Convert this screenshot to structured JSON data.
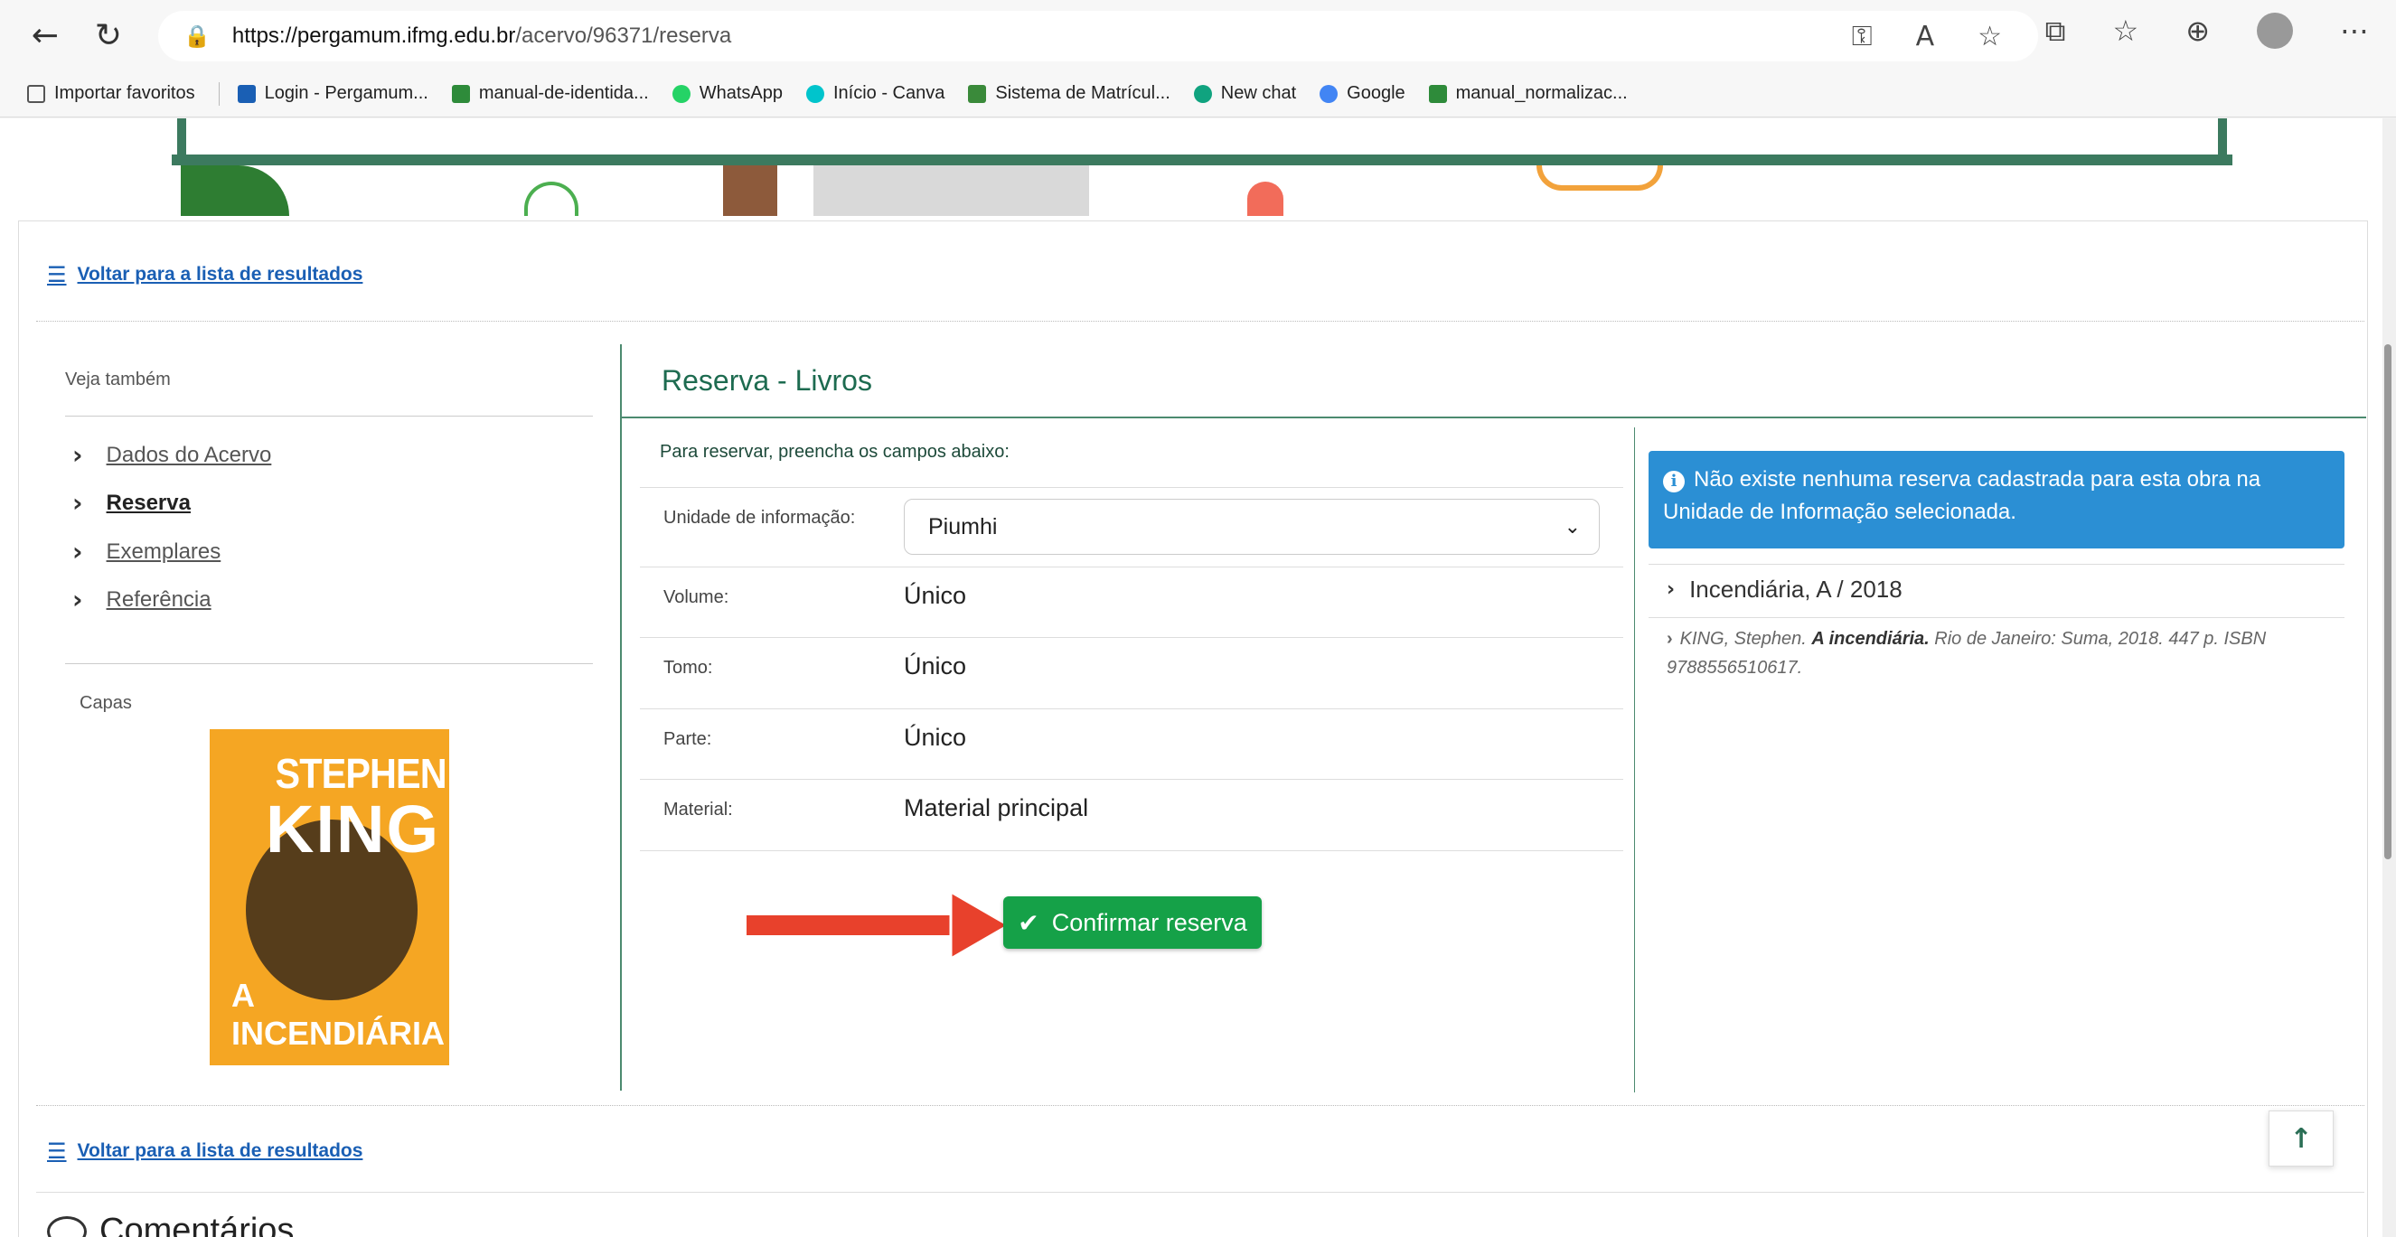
{
  "browser": {
    "url_host": "https://pergamum.ifmg.edu.br",
    "url_path": "/acervo/96371/reserva",
    "back_icon": "arrow-left-icon",
    "reload_icon": "reload-icon"
  },
  "bookmarks": [
    {
      "label": "Importar favoritos",
      "color": "#555555"
    },
    {
      "label": "Login - Pergamum...",
      "color": "#1a5fb4"
    },
    {
      "label": "manual-de-identida...",
      "color": "#2e8b3a"
    },
    {
      "label": "WhatsApp",
      "color": "#25d366"
    },
    {
      "label": "Início - Canva",
      "color": "#00c4cc"
    },
    {
      "label": "Sistema de Matrícul...",
      "color": "#3a8a3a"
    },
    {
      "label": "New chat",
      "color": "#10a37f"
    },
    {
      "label": "Google",
      "color": "#4285f4"
    },
    {
      "label": "manual_normalizac...",
      "color": "#2e8b3a"
    }
  ],
  "nav": {
    "back_to_results": "Voltar para a lista de resultados"
  },
  "sidebar": {
    "heading": "Veja também",
    "items": [
      {
        "label": "Dados do Acervo"
      },
      {
        "label": "Reserva"
      },
      {
        "label": "Exemplares"
      },
      {
        "label": "Referência"
      }
    ],
    "covers_label": "Capas",
    "cover_author_1": "STEPHEN",
    "cover_author_2": "KING",
    "cover_title": "A INCENDIÁRIA"
  },
  "main": {
    "title": "Reserva - Livros",
    "instructions": "Para reservar, preencha os campos abaixo:",
    "fields": [
      {
        "label": "Unidade de informação:",
        "value": "Piumhi"
      },
      {
        "label": "Volume:",
        "value": "Único"
      },
      {
        "label": "Tomo:",
        "value": "Único"
      },
      {
        "label": "Parte:",
        "value": "Único"
      },
      {
        "label": "Material:",
        "value": "Material principal"
      }
    ],
    "confirm_label": "Confirmar reserva"
  },
  "right_panel": {
    "info": "Não existe nenhuma reserva cadastrada para esta obra na Unidade de Informação selecionada.",
    "ref_title": "Incendiária, A / 2018",
    "ref_author": "KING, Stephen.",
    "ref_book": "A incendiária.",
    "ref_rest": "Rio de Janeiro: Suma, 2018. 447 p. ISBN 9788556510617."
  },
  "footer": {
    "comments": "Comentários"
  },
  "colors": {
    "accent_green": "#4c8a6f",
    "button_green": "#15a148",
    "info_blue": "#2b8fd4",
    "link_blue": "#1a5fb4",
    "arrow_red": "#e8412c"
  }
}
